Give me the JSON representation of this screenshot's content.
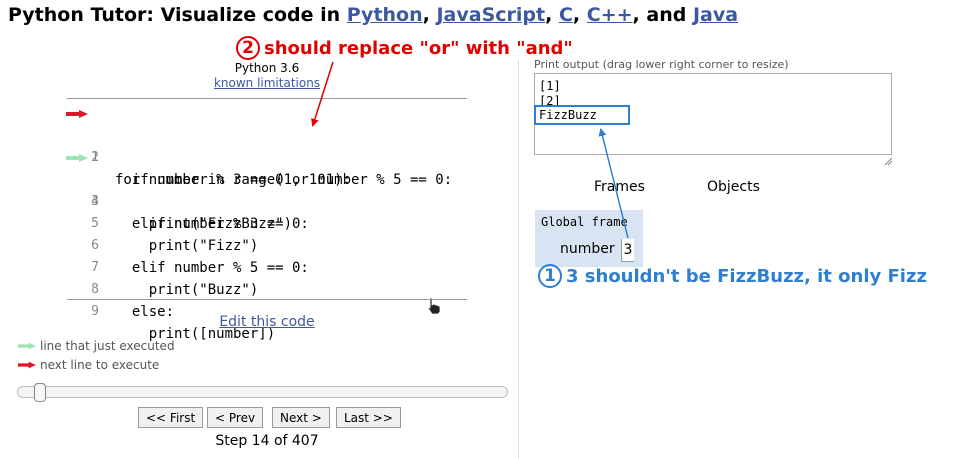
{
  "header": {
    "prefix": "Python Tutor: Visualize code in ",
    "lang1": "Python",
    "sep1": ", ",
    "lang2": "JavaScript",
    "sep2": ", ",
    "lang3": "C",
    "sep3": ", ",
    "lang4": "C++",
    "sep4": ", and ",
    "lang5": "Java"
  },
  "annotations": {
    "a2_number": "2",
    "a2_text": "should replace \"or\" with \"and\"",
    "a1_number": "1",
    "a1_text": "3 shouldn't be FizzBuzz, it only Fizz"
  },
  "editor": {
    "version": "Python 3.6",
    "limitations": "known limitations",
    "lines": [
      {
        "num": "1",
        "code": "for number in range(1, 101):"
      },
      {
        "num": "2",
        "code": "  if number % 3 == 0 or number % 5 == 0:"
      },
      {
        "num": "3",
        "code": "    print(\"FizzBuzz\")"
      },
      {
        "num": "4",
        "code": "  elif number % 3 == 0:"
      },
      {
        "num": "5",
        "code": "    print(\"Fizz\")"
      },
      {
        "num": "6",
        "code": "  elif number % 5 == 0:"
      },
      {
        "num": "7",
        "code": "    print(\"Buzz\")"
      },
      {
        "num": "8",
        "code": "  else:"
      },
      {
        "num": "9",
        "code": "    print([number])"
      }
    ],
    "edit_link": "Edit this code",
    "legend_executed": "line that just executed",
    "legend_next": "next line to execute",
    "colors": {
      "executed": "#9fe2b4",
      "next": "#e0142b"
    }
  },
  "navigation": {
    "first": "<< First",
    "prev": "< Prev",
    "next": "Next >",
    "last": "Last >>",
    "step": "Step 14 of 407",
    "progress_fraction": 0.032
  },
  "output": {
    "label": "Print output (drag lower right corner to resize)",
    "lines": [
      "[1]",
      "[2]",
      "FizzBuzz"
    ]
  },
  "viz": {
    "frames_label": "Frames",
    "objects_label": "Objects",
    "global_frame": "Global frame",
    "var_name": "number",
    "var_value": "3"
  }
}
